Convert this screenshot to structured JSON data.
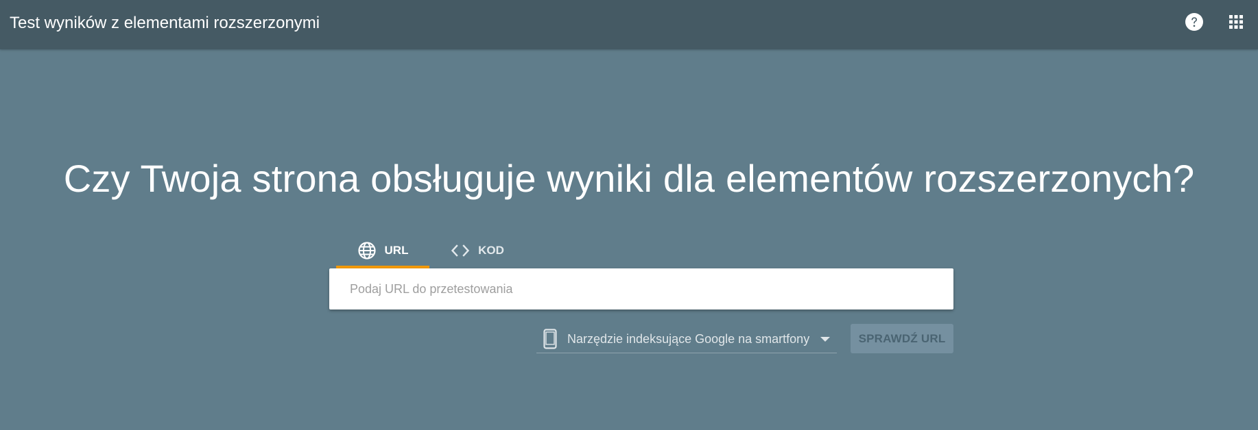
{
  "header": {
    "title": "Test wyników z elementami rozszerzonymi",
    "help_icon": "help-icon",
    "apps_icon": "apps-grid-icon"
  },
  "main": {
    "headline": "Czy Twoja strona obsługuje wyniki dla elementów rozszerzonych?",
    "tabs": [
      {
        "label": "URL",
        "icon": "globe-icon",
        "selected": true
      },
      {
        "label": "KOD",
        "icon": "code-icon",
        "selected": false
      }
    ],
    "url_input": {
      "value": "",
      "placeholder": "Podaj URL do przetestowania"
    },
    "crawler_select": {
      "icon": "smartphone-icon",
      "selected": "Narzędzie indeksujące Google na smartfony"
    },
    "check_button": {
      "label": "SPRAWDŹ URL",
      "enabled": false
    }
  },
  "colors": {
    "page_background": "#607d8b",
    "topbar_background": "#455a64",
    "tab_indicator": "#f29900",
    "input_background": "#ffffff",
    "button_disabled": "#7590a0"
  }
}
